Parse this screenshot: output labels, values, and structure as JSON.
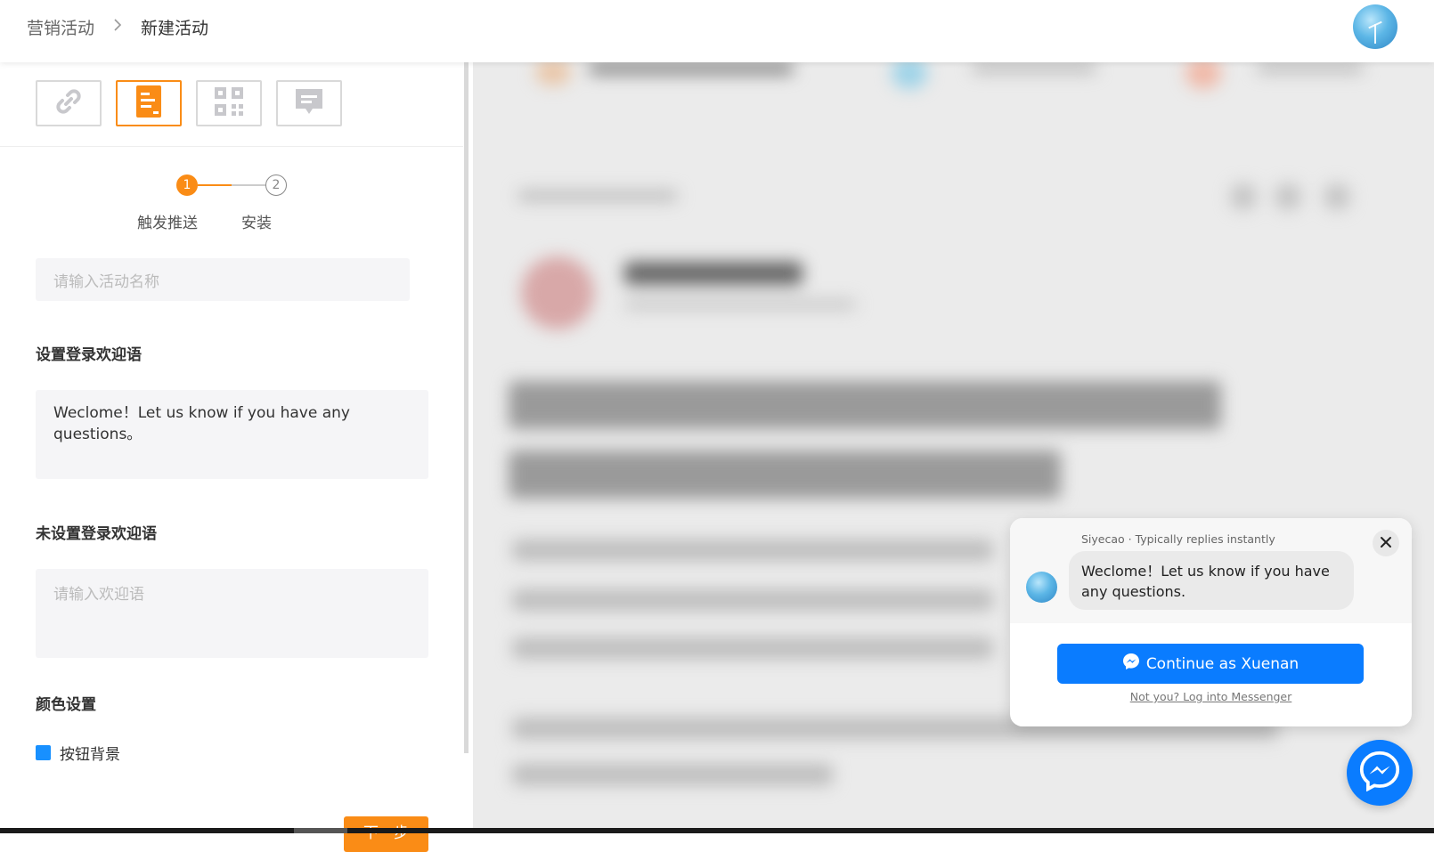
{
  "header": {
    "breadcrumb": [
      "营销活动",
      "新建活动"
    ],
    "separator": ">",
    "avatar_icon": "user-avatar"
  },
  "type_tabs": [
    {
      "icon": "link-icon",
      "active": false
    },
    {
      "icon": "booklet-icon",
      "active": true
    },
    {
      "icon": "qrcode-icon",
      "active": false
    },
    {
      "icon": "message-icon",
      "active": false
    }
  ],
  "steps": [
    {
      "number": "1",
      "label": "触发推送",
      "active": true
    },
    {
      "number": "2",
      "label": "安装",
      "active": false
    }
  ],
  "form": {
    "activity_name_placeholder": "请输入活动名称",
    "activity_name_value": "",
    "welcome_label": "设置登录欢迎语",
    "welcome_value": "Weclome！Let us know if you have any questions。",
    "unlogged_label": "未设置登录欢迎语",
    "unlogged_placeholder": "请输入欢迎语",
    "color_label": "颜色设置",
    "button_bg_label": "按钮背景",
    "button_bg_color": "#1890ff",
    "next_label": "下一步"
  },
  "messenger": {
    "meta": "Siyecao · Typically replies instantly",
    "bubble": "Weclome！Let us know if you have any questions.",
    "continue_label": "Continue as Xuenan",
    "login_link": "Not you? Log into Messenger",
    "brand_color": "#0a7cff"
  },
  "colors": {
    "accent": "#fa8c16",
    "primary": "#1890ff"
  }
}
